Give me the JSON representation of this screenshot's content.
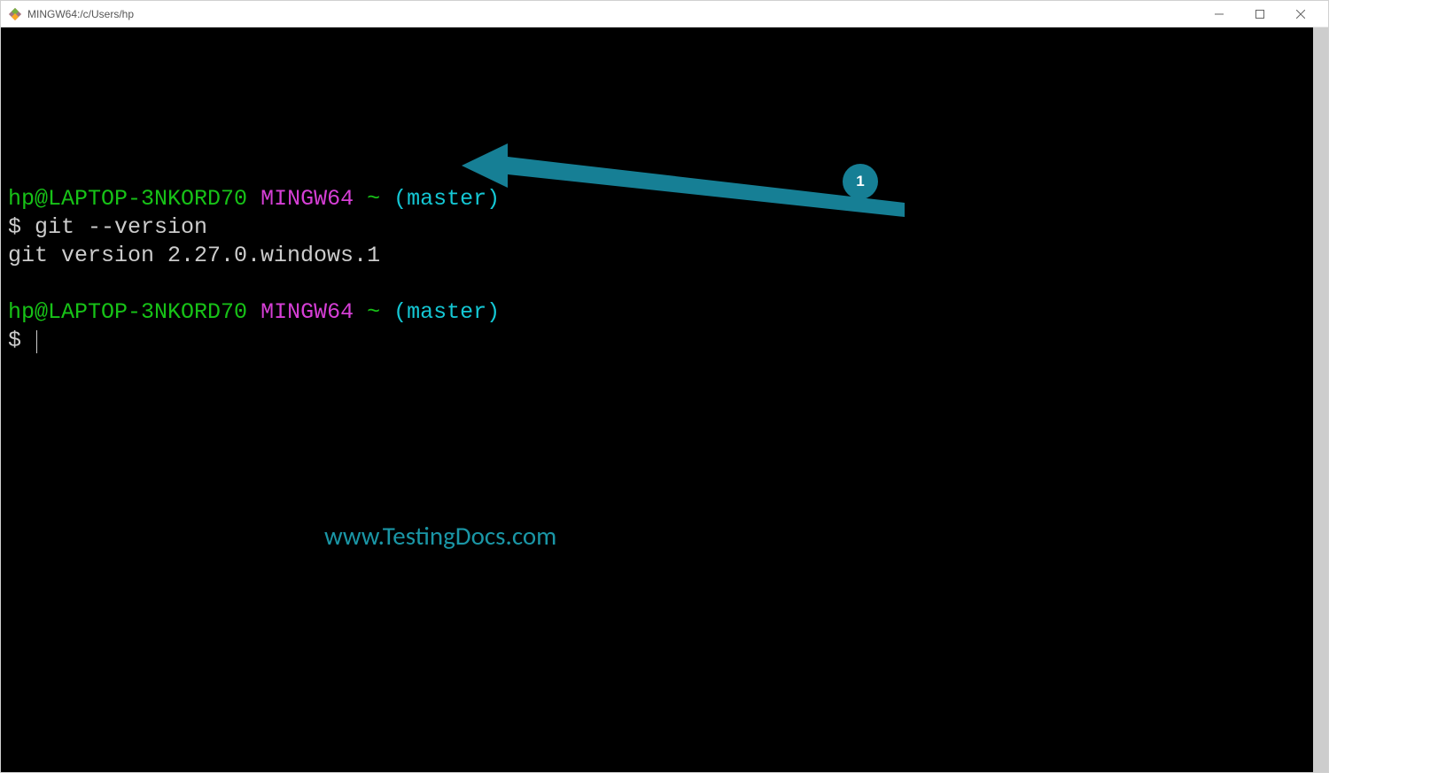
{
  "window": {
    "title": "MINGW64:/c/Users/hp"
  },
  "colors": {
    "prompt_user": "#17c217",
    "prompt_env": "#d63fd6",
    "prompt_branch": "#14c7d4",
    "terminal_fg": "#cccccc",
    "terminal_bg": "#000000",
    "annotation": "#167f95"
  },
  "terminal": {
    "lines": [
      {
        "type": "prompt",
        "user": "hp@LAPTOP-3NKORD70",
        "env": "MINGW64",
        "tilde": "~",
        "branch": "(master)"
      },
      {
        "type": "command",
        "sigil": "$",
        "text": "git --version"
      },
      {
        "type": "output",
        "text": "git version 2.27.0.windows.1"
      },
      {
        "type": "blank"
      },
      {
        "type": "prompt",
        "user": "hp@LAPTOP-3NKORD70",
        "env": "MINGW64",
        "tilde": "~",
        "branch": "(master)"
      },
      {
        "type": "command",
        "sigil": "$",
        "text": "",
        "cursor": true
      }
    ]
  },
  "annotation": {
    "badge_number": "1"
  },
  "watermark": {
    "text": "www.TestingDocs.com"
  }
}
